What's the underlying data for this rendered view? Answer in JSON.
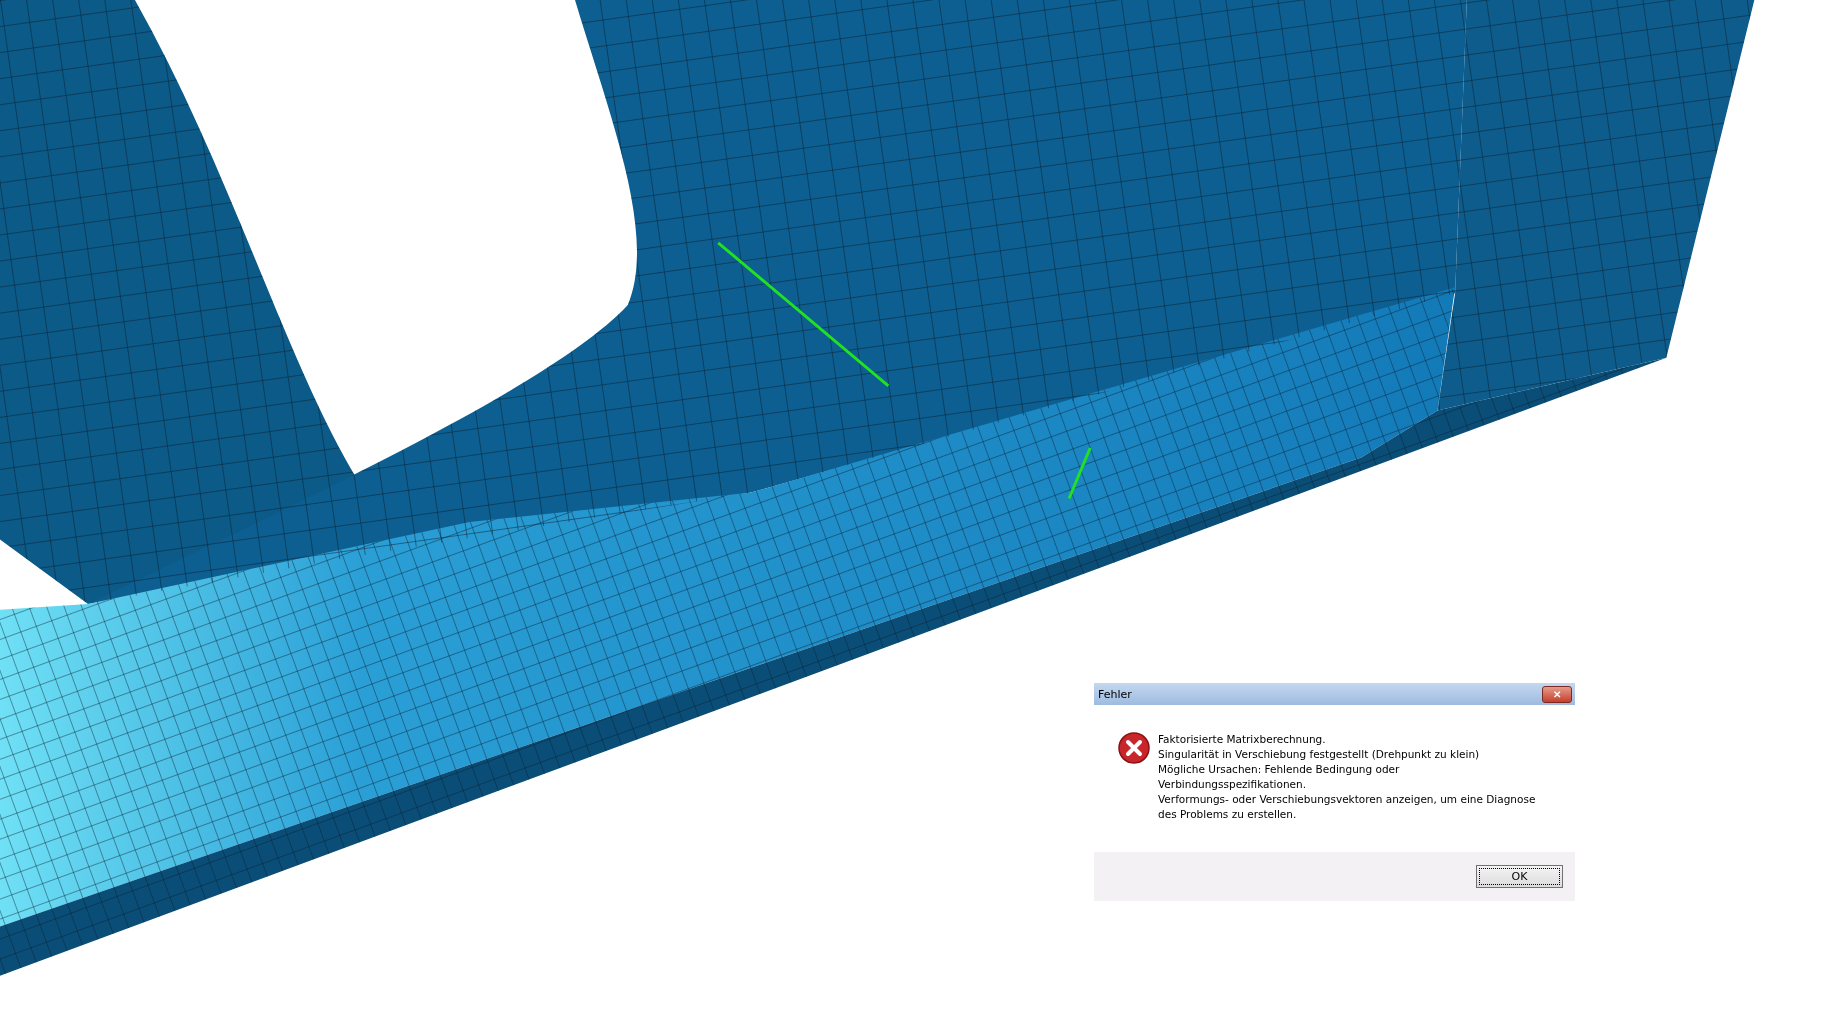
{
  "dialog": {
    "title": "Fehler",
    "close_label": "✕",
    "message_lines": [
      "Faktorisierte Matrixberechnung.",
      "Singularität in Verschiebung festgestellt (Drehpunkt zu klein)",
      "Mögliche Ursachen: Fehlende Bedingung oder",
      "Verbindungsspezifikationen.",
      "Verformungs- oder Verschiebungsvektoren anzeigen, um eine Diagnose",
      "des Problems zu erstellen."
    ],
    "buttons": [
      "OK"
    ]
  }
}
